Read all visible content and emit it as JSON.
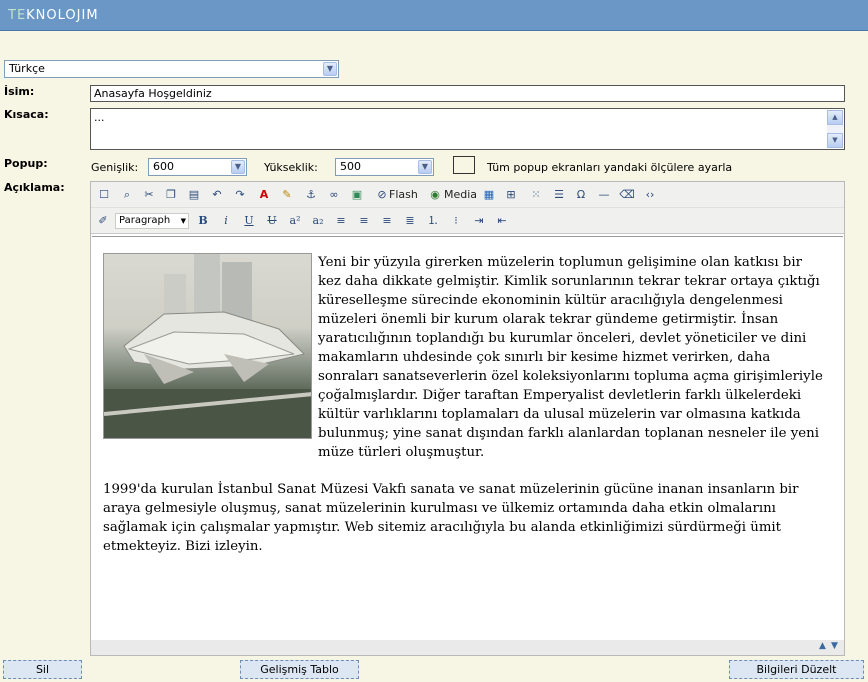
{
  "header": {
    "logo_te": "TE",
    "logo_rest": "KNOLOJIM"
  },
  "language": {
    "selected": "Türkçe"
  },
  "fields": {
    "isim_label": "İsim:",
    "isim_value": "Anasayfa Hoşgeldiniz",
    "kisaca_label": "Kısaca:",
    "kisaca_value": "...",
    "popup_label": "Popup:",
    "genislik_label": "Genişlik:",
    "genislik_value": "600",
    "yukseklik_label": "Yükseklik:",
    "yukseklik_value": "500",
    "popup_checkbox_label": "Tüm popup ekranları yandaki ölçülere ayarla",
    "aciklama_label": "Açıklama:"
  },
  "toolbar": {
    "flash_label": "Flash",
    "media_label": "Media",
    "format_value": "Paragraph"
  },
  "content": {
    "paragraph1": "Yeni bir yüzyıla girerken müzelerin toplumun gelişimine olan katkısı bir kez daha dikkate gelmiştir. Kimlik sorunlarının tekrar tekrar ortaya çıktığı küreselleşme sürecinde ekonominin kültür aracılığıyla dengelenmesi müzeleri önemli bir kurum olarak tekrar gündeme getirmiştir. İnsan yaratıcılığının toplandığı bu kurumlar önceleri, devlet yöneticiler ve dini makamların uhdesinde çok sınırlı bir kesime hizmet verirken, daha sonraları sanatseverlerin özel koleksiyonlarını topluma açma girişimleriyle çoğalmışlardır. Diğer taraftan Emperyalist devletlerin farklı ülkelerdeki kültür varlıklarını toplamaları da ulusal müzelerin var olmasına katkıda bulunmuş; yine sanat dışından farklı alanlardan toplanan nesneler ile yeni müze türleri oluşmuştur.",
    "paragraph2": "1999'da kurulan İstanbul Sanat Müzesi Vakfı sanata ve sanat müzelerinin gücüne inanan insanların bir araya gelmesiyle oluşmuş, sanat müzelerinin kurulması ve ülkemiz ortamında daha etkin olmalarını sağlamak için çalışmalar yapmıştır. Web sitemiz aracılığıyla bu alanda etkinliğimizi sürdürmeği ümit etmekteyiz. Bizi izleyin."
  },
  "buttons": {
    "sil": "Sil",
    "gelismis_tablo": "Gelişmiş Tablo",
    "bilgileri_duzelt": "Bilgileri Düzelt"
  }
}
